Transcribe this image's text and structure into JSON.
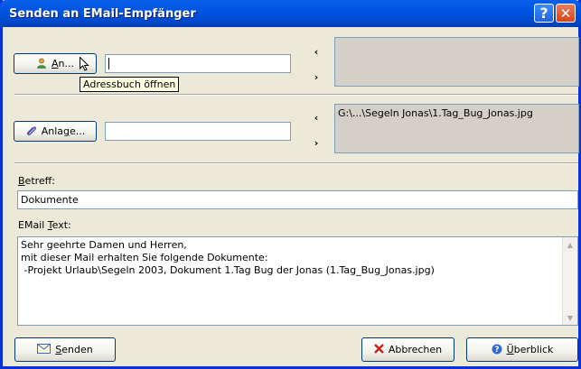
{
  "window": {
    "title": "Senden an EMail-Empfänger",
    "help_glyph": "?",
    "close_glyph": "✕"
  },
  "recipients": {
    "button_label_underlined": "A",
    "button_label_rest": "n...",
    "input_value": "",
    "add_arrow": "‹",
    "remove_arrow": "›",
    "selected_list": "",
    "tooltip": "Adressbuch öffnen"
  },
  "attachments": {
    "button_label_prefix": "Anla",
    "button_label_underlined": "g",
    "button_label_suffix": "e...",
    "input_value": "",
    "add_arrow": "‹",
    "remove_arrow": "›",
    "selected_list": "G:\\...\\Segeln Jonas\\1.Tag_Bug_Jonas.jpg"
  },
  "subject": {
    "label_underlined": "B",
    "label_rest": "etreff:",
    "value": "Dokumente"
  },
  "body": {
    "label_prefix": "EMail ",
    "label_underlined": "T",
    "label_rest": "ext:",
    "lines": [
      "Sehr geehrte Damen und Herren,",
      "mit dieser Mail erhalten Sie folgende Dokumente:",
      " -Projekt Urlaub\\Segeln 2003, Dokument 1.Tag Bug der Jonas (1.Tag_Bug_Jonas.jpg)"
    ]
  },
  "buttons": {
    "send_underlined": "S",
    "send_rest": "enden",
    "cancel": "Abbrechen",
    "overview_underlined": "Ü",
    "overview_rest": "berblick"
  },
  "colors": {
    "title_bar": "#0054e3",
    "dialog_bg": "#ece9d8",
    "cancel_x": "#c8211b"
  },
  "icons": {
    "recipient": "person-icon",
    "attachment": "paperclip-icon",
    "send": "envelope-icon",
    "cancel": "x-icon",
    "overview": "help-icon"
  }
}
